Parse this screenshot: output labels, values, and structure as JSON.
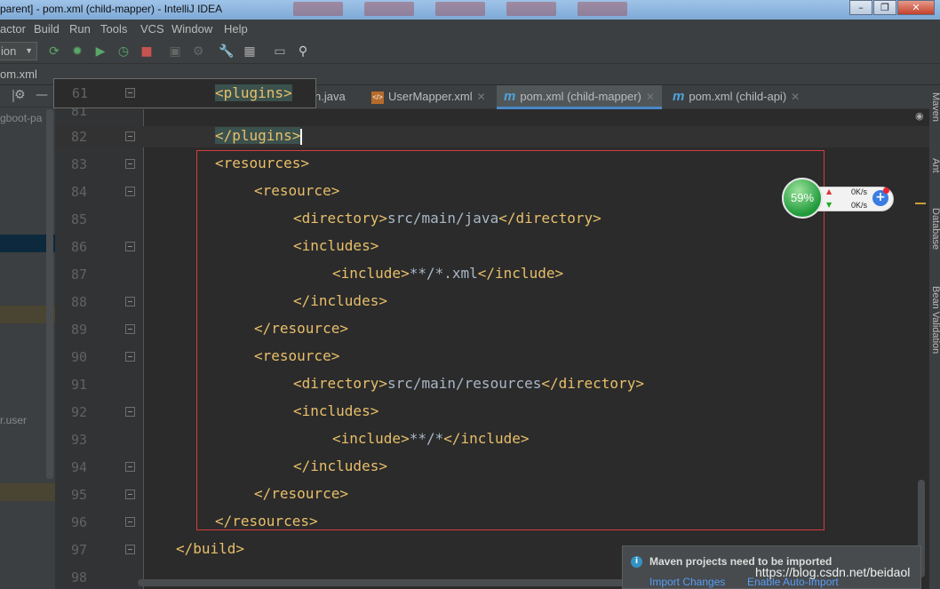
{
  "window": {
    "title": "parent] - pom.xml (child-mapper) - IntelliJ IDEA"
  },
  "menu": {
    "items": [
      "actor",
      "Build",
      "Run",
      "Tools",
      "VCS",
      "Window",
      "Help"
    ]
  },
  "toolbar": {
    "run_config": "ion"
  },
  "breadcrumb": "om.xml",
  "project_panel": {
    "items": [
      "gboot-pa",
      "r.user"
    ]
  },
  "tabs": [
    {
      "label": "n.java",
      "icon": "java-icon",
      "closable": false
    },
    {
      "label": "UserMapper.xml",
      "icon": "xml-icon",
      "closable": true
    },
    {
      "label": "pom.xml (child-mapper)",
      "icon": "maven-icon",
      "closable": true,
      "active": true
    },
    {
      "label": "pom.xml (child-api)",
      "icon": "maven-icon",
      "closable": true
    }
  ],
  "sticky_line": {
    "number": "61",
    "text": "<plugins>"
  },
  "code_lines": [
    {
      "num": "81",
      "text": ""
    },
    {
      "num": "82",
      "text": "</plugins>"
    },
    {
      "num": "83",
      "text": "<resources>"
    },
    {
      "num": "84",
      "text": "<resource>"
    },
    {
      "num": "85",
      "open": "<directory>",
      "body": "src/main/java",
      "close": "</directory>"
    },
    {
      "num": "86",
      "text": "<includes>"
    },
    {
      "num": "87",
      "open": "<include>",
      "body": "**/*.xml",
      "close": "</include>"
    },
    {
      "num": "88",
      "text": "</includes>"
    },
    {
      "num": "89",
      "text": "</resource>"
    },
    {
      "num": "90",
      "text": "<resource>"
    },
    {
      "num": "91",
      "open": "<directory>",
      "body": "src/main/resources",
      "close": "</directory>"
    },
    {
      "num": "92",
      "text": "<includes>"
    },
    {
      "num": "93",
      "open": "<include>",
      "body": "**/*",
      "close": "</include>"
    },
    {
      "num": "94",
      "text": "</includes>"
    },
    {
      "num": "95",
      "text": "</resource>"
    },
    {
      "num": "96",
      "text": "</resources>"
    },
    {
      "num": "97",
      "text": "</build>"
    },
    {
      "num": "98",
      "text": ""
    }
  ],
  "right_tools": [
    "Maven",
    "Ant",
    "Database",
    "Bean Validation"
  ],
  "net_widget": {
    "percent": "59%",
    "upload": "0K/s",
    "download": "0K/s"
  },
  "notification": {
    "message": "Maven projects need to be imported",
    "link_import": "Import Changes",
    "link_auto": "Enable Auto-Import"
  },
  "watermark": "https://blog.csdn.net/beidaol",
  "colors": {
    "tag": "#e8bf6a",
    "text": "#a9b7c6",
    "selection_box": "#d63b3b",
    "active_tab_underline": "#4a88c7",
    "link": "#589df6"
  }
}
